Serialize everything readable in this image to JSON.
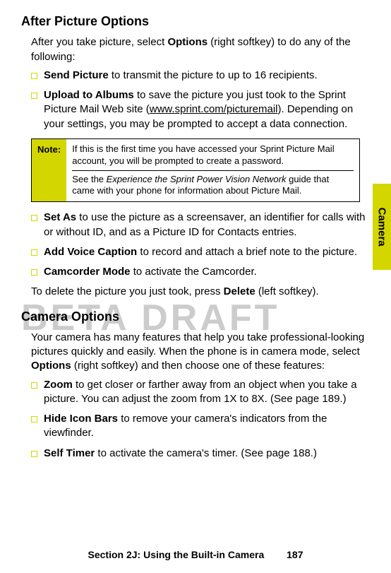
{
  "watermark": "BETA DRAFT",
  "sideTab": "Camera",
  "heading1": "After Picture Options",
  "intro1_part1": "After you take picture, select ",
  "intro1_bold": "Options",
  "intro1_part2": " (right softkey) to do any of the following:",
  "list1": {
    "item1_bold": "Send Picture",
    "item1_rest": " to transmit the picture to up to 16 recipients.",
    "item2_bold": "Upload to Albums",
    "item2_part1": " to save the picture you just took to the Sprint Picture Mail Web site (",
    "item2_url": "www.sprint.com/picturemail",
    "item2_part2": "). Depending on your settings, you may be prompted to accept a data connection."
  },
  "note": {
    "label": "Note:",
    "line1": "If this is the first time you have accessed your Sprint Picture Mail account, you will be prompted to create a password.",
    "line2_part1": "See the ",
    "line2_italic": "Experience the Sprint Power Vision Network",
    "line2_part2": " guide that came with your phone for information about Picture Mail."
  },
  "list2": {
    "item1_bold": "Set As",
    "item1_rest": " to use the picture as a screensaver, an identifier for calls with or without ID, and as a Picture ID for Contacts entries.",
    "item2_bold": "Add Voice Caption",
    "item2_rest": " to record and attach a brief note to the picture.",
    "item3_bold": "Camcorder Mode",
    "item3_rest": " to activate the Camcorder."
  },
  "deleteLine_part1": "To delete the picture you just took, press ",
  "deleteLine_bold": "Delete",
  "deleteLine_part2": " (left softkey).",
  "heading2": "Camera Options",
  "intro2_part1": "Your camera has many features that help you take professional-looking pictures quickly and easily. When the phone is in camera mode, select ",
  "intro2_bold": "Options",
  "intro2_part2": " (right softkey) and then choose one of these features:",
  "list3": {
    "item1_bold": "Zoom",
    "item1_rest": " to get closer or farther away from an object when you take a picture. You can adjust the zoom from 1X to 8X. (See page 189.)",
    "item2_bold": "Hide Icon Bars",
    "item2_rest": " to remove your camera's indicators from the viewfinder.",
    "item3_bold": "Self Timer",
    "item3_rest": " to activate the camera's timer. (See page 188.)"
  },
  "footer": {
    "section": "Section 2J: Using the Built-in Camera",
    "page": "187"
  }
}
